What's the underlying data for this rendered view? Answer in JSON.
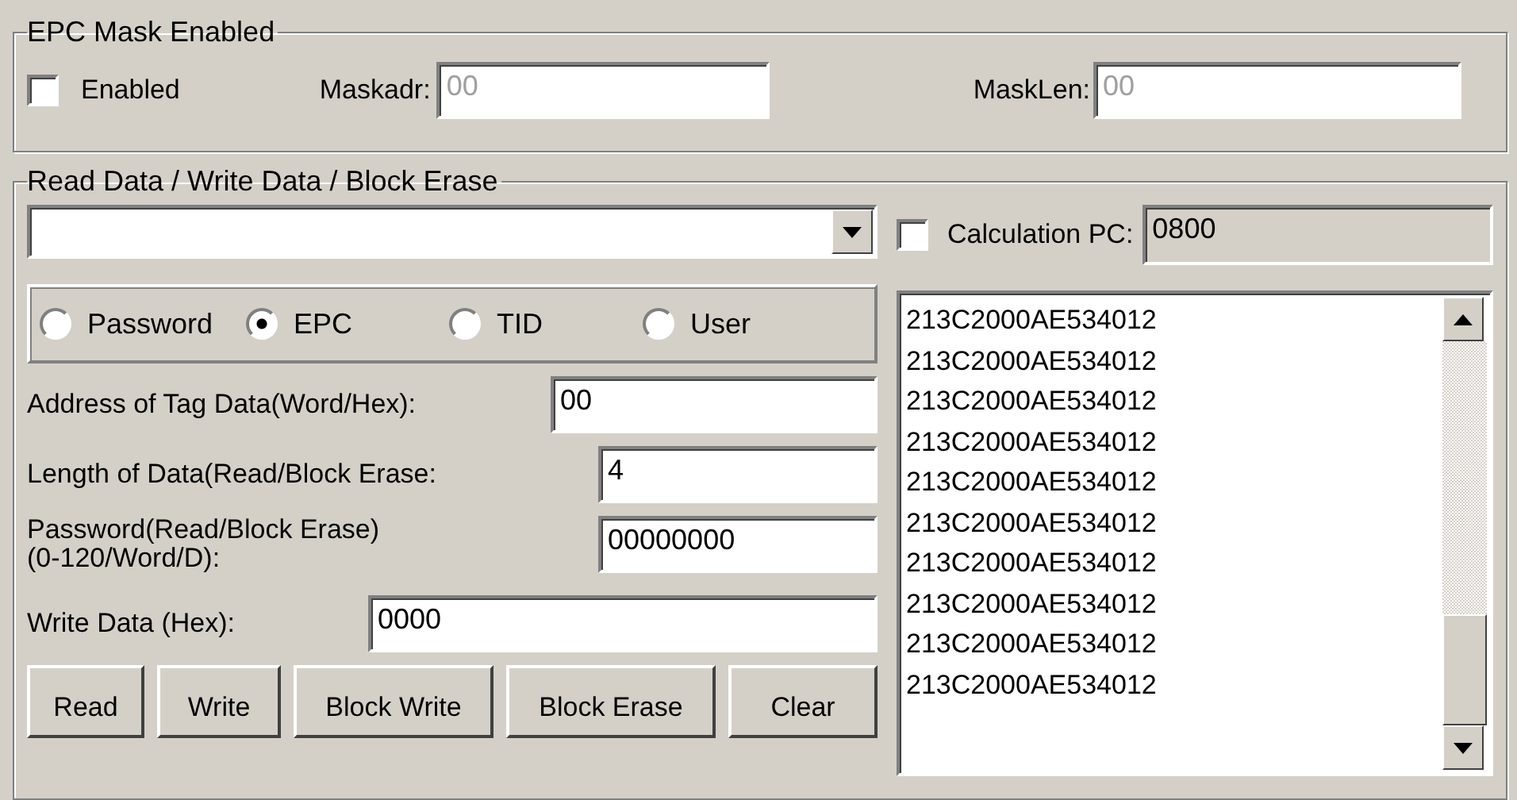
{
  "mask_group": {
    "title": "EPC Mask Enabled",
    "enabled_checkbox": {
      "label": "Enabled",
      "checked": false
    },
    "fields": [
      {
        "label": "Maskadr:",
        "value": "00",
        "disabled": true
      },
      {
        "label": "MaskLen:",
        "value": "00",
        "disabled": true
      }
    ]
  },
  "rw_group": {
    "title": "Read Data / Write Data / Block Erase",
    "calc_pc": {
      "label": "Calculation PC:",
      "checked": false,
      "value": "0800"
    },
    "memory_banks": [
      {
        "label": "Password",
        "selected": false
      },
      {
        "label": "EPC",
        "selected": true
      },
      {
        "label": "TID",
        "selected": false
      },
      {
        "label": "User",
        "selected": false
      }
    ],
    "fields": [
      {
        "label": "Address of Tag Data(Word/Hex):",
        "value": "00",
        "kind": "wide"
      },
      {
        "label": "Length of Data(Read/Block Erase:",
        "value": "4",
        "kind": "narrow"
      },
      {
        "label": "Password(Read/Block Erase)\n(0-120/Word/D):",
        "value": "00000000",
        "kind": "narrow"
      },
      {
        "label": "Write Data (Hex):",
        "value": "0000",
        "kind": "long"
      }
    ],
    "buttons": [
      "Read",
      "Write",
      "Block Write",
      "Block Erase",
      "Clear"
    ],
    "results": [
      "213C2000AE534012",
      "213C2000AE534012",
      "213C2000AE534012",
      "213C2000AE534012",
      "213C2000AE534012",
      "213C2000AE534012",
      "213C2000AE534012",
      "213C2000AE534012",
      "213C2000AE534012",
      "213C2000AE534012"
    ]
  }
}
